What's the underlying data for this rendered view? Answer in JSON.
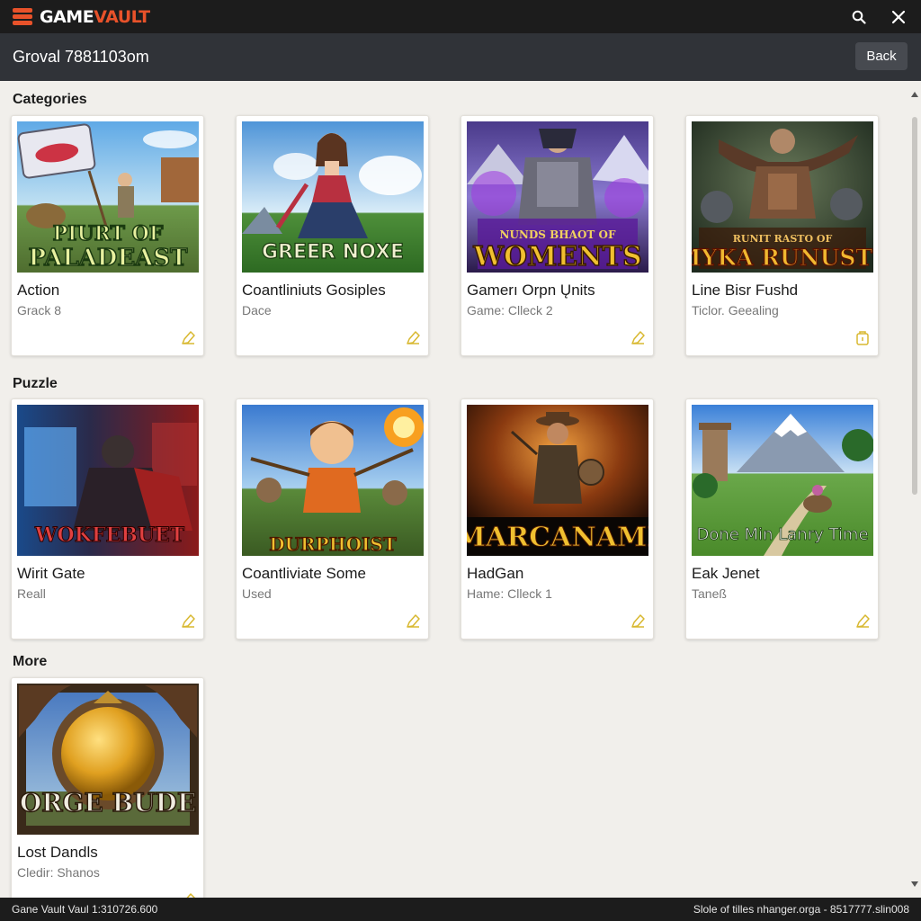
{
  "app": {
    "logo_part1": "GAME",
    "logo_part2": "VAULT",
    "accent": "#e8522a",
    "icons": [
      "search-icon",
      "close-icon"
    ]
  },
  "header": {
    "title": "Groval 7881103om",
    "back_label": "Back"
  },
  "sections": [
    {
      "title": "Categories",
      "cards": [
        {
          "art": "PIURT OF PALADEAST",
          "title": "Action",
          "subtitle": "Grack 8",
          "icon": "pencil-icon"
        },
        {
          "art": "GREER NOXE",
          "title": "Coantliniuts Gosiples",
          "subtitle": "Dace",
          "icon": "pencil-icon"
        },
        {
          "art": "NUNDS BHAOT OF WOMENTS",
          "title": "Gamerı Orpn Ųnits",
          "subtitle": "Game: Clleck 2",
          "icon": "pencil-icon"
        },
        {
          "art": "RUNIT RASTO OF MYKA RUNUSTS",
          "title": "Line Bisr Fushd",
          "subtitle": "Ticlor. Geealing",
          "icon": "tag-icon"
        }
      ]
    },
    {
      "title": "Puzzle",
      "cards": [
        {
          "art": "WOKFEBUET",
          "title": "Wirit Gate",
          "subtitle": "Reall",
          "icon": "pencil-icon"
        },
        {
          "art": "DURPHOIST",
          "title": "Coantliviate Some",
          "subtitle": "Used",
          "icon": "pencil-icon"
        },
        {
          "art": "MARCANAMI",
          "title": "HadGan",
          "subtitle": "Hame: Clleck 1",
          "icon": "pencil-icon"
        },
        {
          "art": "Done Min Lanry Time",
          "title": "Eak Jenet",
          "subtitle": "Taneß",
          "icon": "pencil-icon"
        }
      ]
    },
    {
      "title": "More",
      "cards": [
        {
          "art": "ORGE BUDE",
          "title": "Lost Dandls",
          "subtitle": "Cledir: Shanos",
          "icon": "pencil-icon"
        }
      ]
    }
  ],
  "footer": {
    "left": "Gane Vault Vaul 1:310726.600",
    "right": "Slole of tilles nhanger.orga - 8517777.slin008"
  }
}
